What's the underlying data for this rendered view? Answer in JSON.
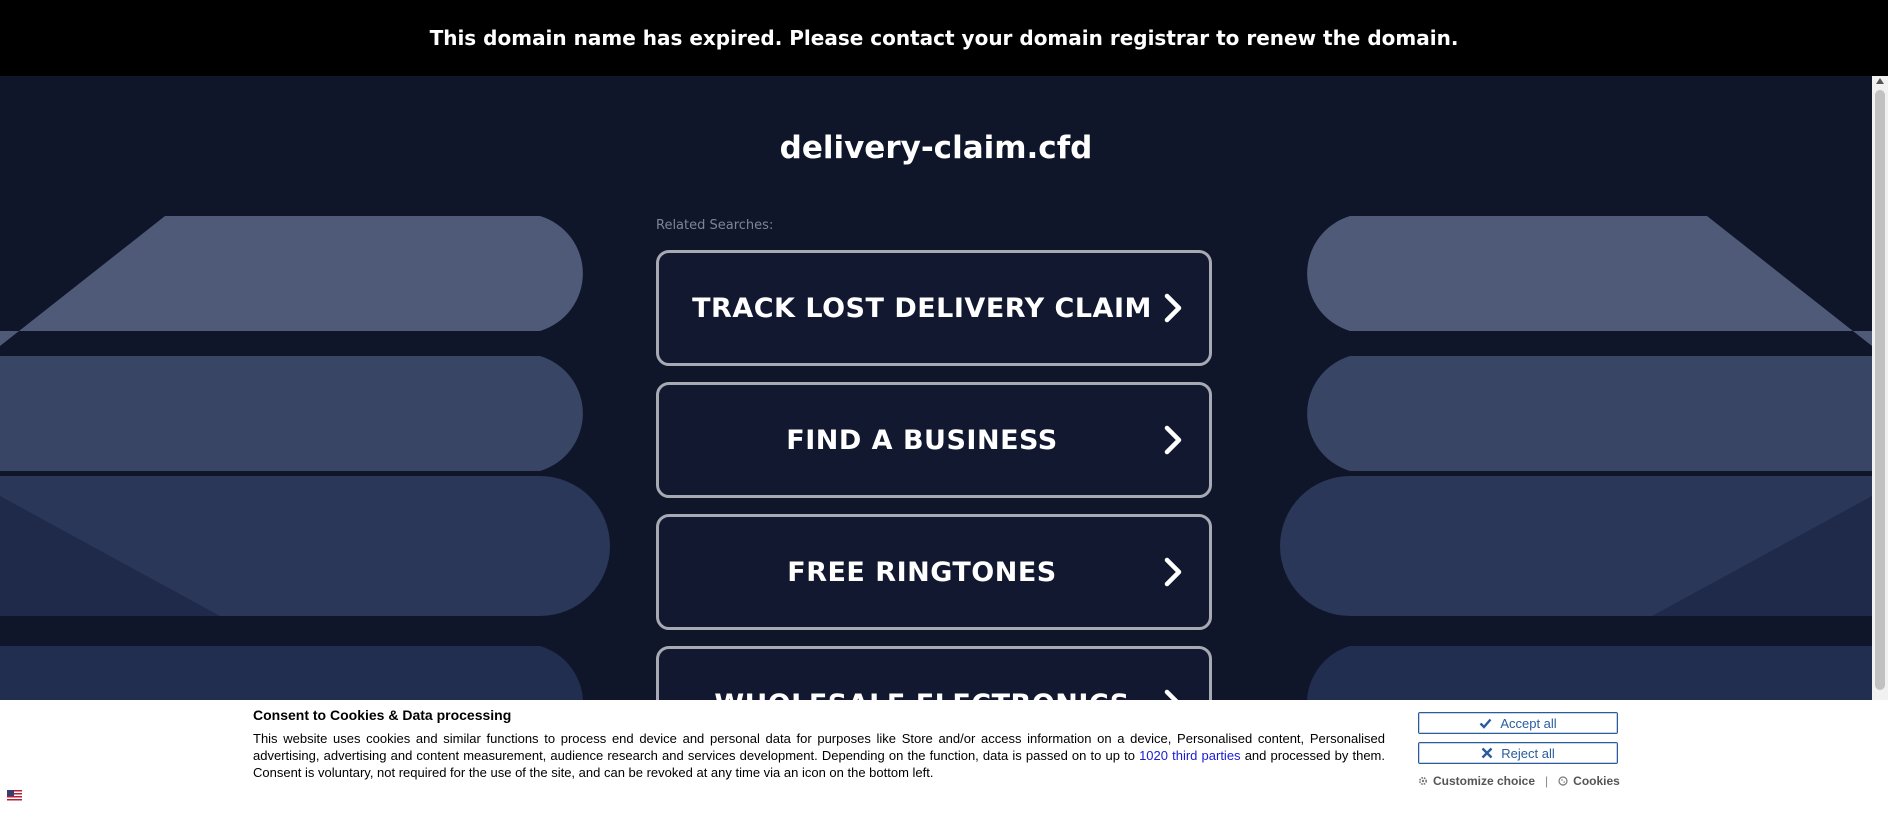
{
  "banner": {
    "text": "This domain name has expired. Please contact your domain registrar to renew the domain."
  },
  "domain": {
    "name": "delivery-claim.cfd"
  },
  "related": {
    "label": "Related Searches:",
    "items": [
      {
        "label": "TRACK LOST DELIVERY CLAIM"
      },
      {
        "label": "FIND A BUSINESS"
      },
      {
        "label": "FREE RINGTONES"
      },
      {
        "label": "WHOLESALE ELECTRONICS"
      }
    ]
  },
  "consent": {
    "title": "Consent to Cookies & Data processing",
    "text_before": "This website uses cookies and similar functions to process end device and personal data for purposes like Store and/or access information on a device, Personalised content, Personalised advertising, advertising and content measurement, audience research and services development. Depending on the function, data is passed on to up to ",
    "link_text": "1020 third parties",
    "text_after": " and processed by them. Consent is voluntary, not required for the use of the site, and can be revoked at any time via an icon on the bottom left.",
    "accept_label": "Accept all",
    "reject_label": "Reject all",
    "customize_label": "Customize choice",
    "separator": "|",
    "cookies_label": "Cookies"
  },
  "colors": {
    "background": "#101629",
    "banner": "#000000",
    "accent": "#2a5b9e"
  }
}
